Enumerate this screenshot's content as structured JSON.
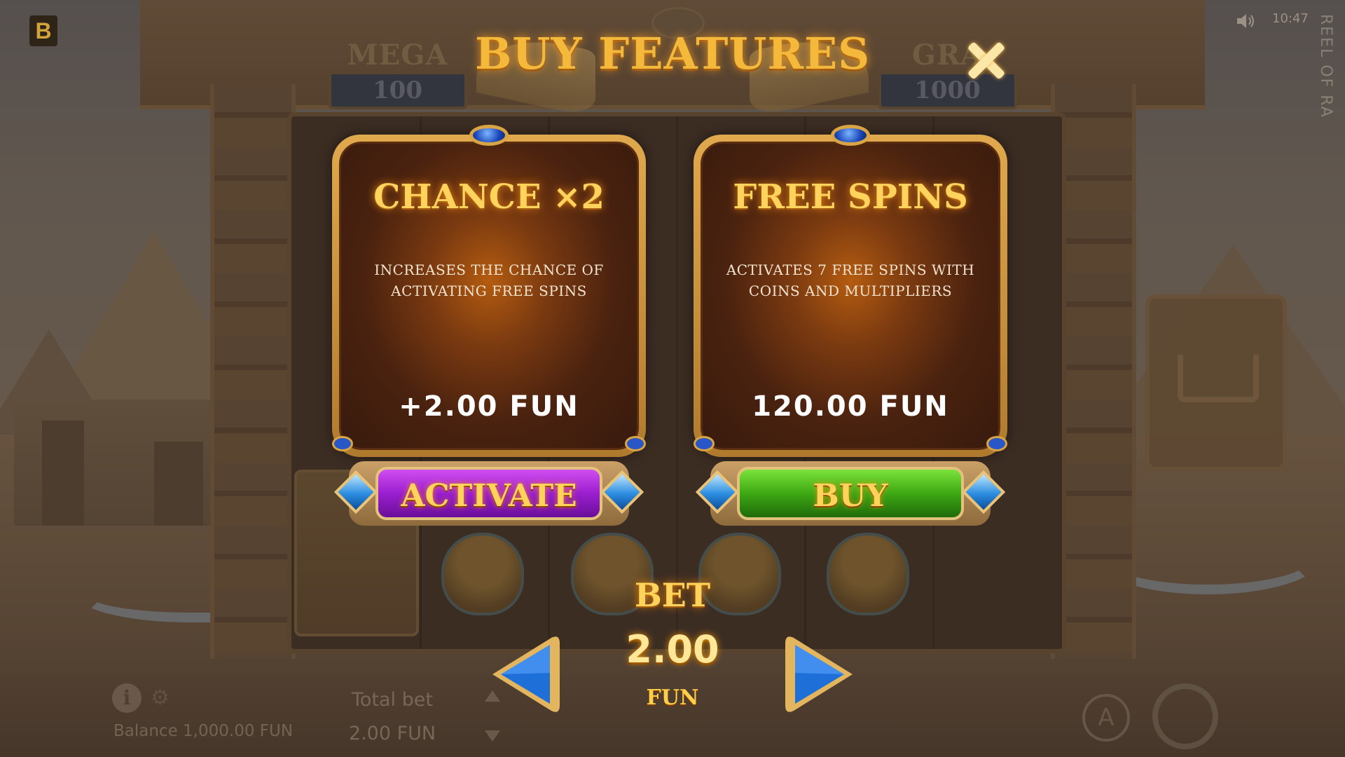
{
  "hud": {
    "logo": "B",
    "time": "10:47",
    "game_title": "REEL OF RA",
    "balance": "Balance 1,000.00 FUN",
    "total_bet_label": "Total bet",
    "total_bet_value": "2.00 FUN",
    "info_symbol": "i",
    "auto_symbol": "A"
  },
  "jackpots": [
    {
      "name": "MEGA",
      "value": "100"
    },
    {
      "name": "GRA",
      "value": "1000"
    }
  ],
  "modal": {
    "title": "BUY FEATURES",
    "features": [
      {
        "title": "CHANCE ×2",
        "description_line1": "INCREASES THE CHANCE OF",
        "description_line2": "ACTIVATING FREE SPINS",
        "price": "+2.00  FUN",
        "button_label": "ACTIVATE",
        "button_color": "#9a1fcf"
      },
      {
        "title": "FREE SPINS",
        "description_line1": "ACTIVATES 7 FREE SPINS WITH",
        "description_line2": "COINS AND MULTIPLIERS",
        "price": "120.00  FUN",
        "button_label": "BUY",
        "button_color": "#3ea814"
      }
    ],
    "bet": {
      "label": "BET",
      "value": "2.00",
      "unit": "FUN"
    }
  },
  "colors": {
    "title_gold": "#f4b93a",
    "card_frame": "#e1a94d",
    "arrow_blue": "#1f6fd8"
  },
  "icons": {
    "close": "close-icon",
    "arrow_left": "arrow-left-icon",
    "arrow_right": "arrow-right-icon",
    "speaker": "speaker-icon",
    "info": "info-icon",
    "settings": "gear-icon",
    "auto": "autoplay-icon",
    "spin": "spin-icon",
    "cart": "cart-icon"
  }
}
